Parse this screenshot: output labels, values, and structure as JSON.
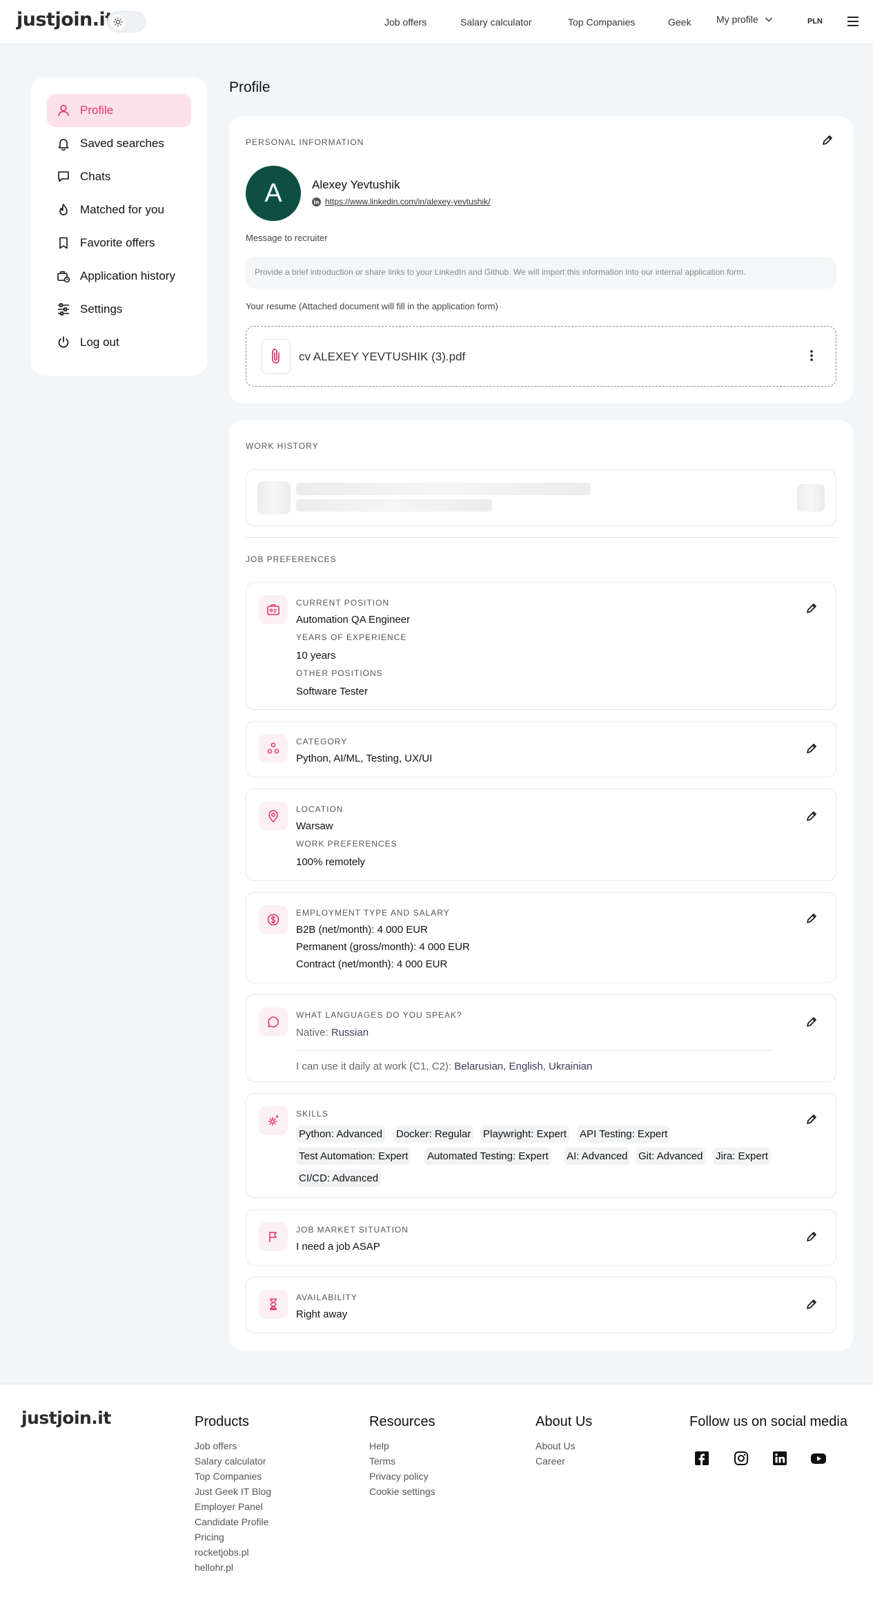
{
  "header": {
    "logo": "justjoin.it",
    "nav": [
      "Job offers",
      "Salary calculator",
      "Top Companies",
      "Geek"
    ],
    "my_profile": "My profile",
    "currency": "PLN"
  },
  "sidebar": {
    "items": [
      {
        "label": "Profile",
        "icon": "person-icon",
        "active": true
      },
      {
        "label": "Saved searches",
        "icon": "bell-icon"
      },
      {
        "label": "Chats",
        "icon": "chat-icon"
      },
      {
        "label": "Matched for you",
        "icon": "flame-icon"
      },
      {
        "label": "Favorite offers",
        "icon": "bookmark-icon"
      },
      {
        "label": "Application history",
        "icon": "briefcase-clock-icon"
      },
      {
        "label": "Settings",
        "icon": "sliders-icon"
      },
      {
        "label": "Log out",
        "icon": "power-icon"
      }
    ]
  },
  "page": {
    "title": "Profile"
  },
  "personal": {
    "section_title": "PERSONAL INFORMATION",
    "avatar_letter": "A",
    "name": "Alexey Yevtushik",
    "linkedin_url": "https://www.linkedin.com/in/alexey-yevtushik/",
    "message_label": "Message to recruiter",
    "message_placeholder": "Provide a brief introduction or share links to your LinkedIn and Github. We will import this information into our internal application form.",
    "resume_label": "Your resume (Attached document will fill in the application form)",
    "resume_file": "cv ALEXEY YEVTUSHIK (3).pdf"
  },
  "work": {
    "section_title": "WORK HISTORY"
  },
  "prefs": {
    "section_title": "JOB PREFERENCES",
    "position": {
      "current_label": "CURRENT POSITION",
      "current_value": "Automation QA Engineer",
      "years_label": "YEARS OF EXPERIENCE",
      "years_value": "10 years",
      "other_label": "OTHER POSITIONS",
      "other_value": "Software Tester"
    },
    "category": {
      "label": "CATEGORY",
      "value": "Python, AI/ML, Testing, UX/UI"
    },
    "location": {
      "label": "LOCATION",
      "value": "Warsaw",
      "work_label": "WORK PREFERENCES",
      "work_value": "100% remotely"
    },
    "employment": {
      "label": "EMPLOYMENT TYPE AND SALARY",
      "b2b_label": "B2B (net/month):",
      "b2b_value": "4 000 EUR",
      "permanent_label": "Permanent (gross/month):",
      "permanent_value": "4 000 EUR",
      "contract_label": "Contract (net/month):",
      "contract_value": "4 000 EUR"
    },
    "languages": {
      "label": "WHAT LANGUAGES DO YOU SPEAK?",
      "native_label": "Native:",
      "native_value": "Russian",
      "daily_label": "I can use it daily at work (C1, C2):",
      "daily_value": "Belarusian, English, Ukrainian"
    },
    "skills": {
      "label": "SKILLS",
      "items": [
        "Python: Advanced",
        "Docker: Regular",
        "Playwright: Expert",
        "API Testing: Expert",
        "Test Automation: Expert",
        "Automated Testing: Expert",
        "AI: Advanced",
        "Git: Advanced",
        "Jira: Expert",
        "CI/CD: Advanced"
      ]
    },
    "market": {
      "label": "JOB MARKET SITUATION",
      "value": "I need a job ASAP"
    },
    "availability": {
      "label": "AVAILABILITY",
      "value": "Right away"
    }
  },
  "footer": {
    "logo": "justjoin.it",
    "products_title": "Products",
    "products": [
      "Job offers",
      "Salary calculator",
      "Top Companies",
      "Just Geek IT Blog",
      "Employer Panel",
      "Candidate Profile",
      "Pricing",
      "rocketjobs.pl",
      "hellohr.pl"
    ],
    "resources_title": "Resources",
    "resources": [
      "Help",
      "Terms",
      "Privacy policy",
      "Cookie settings"
    ],
    "about_title": "About Us",
    "about": [
      "About Us",
      "Career"
    ],
    "social_title": "Follow us on social media",
    "social_icons": [
      "facebook-icon",
      "instagram-icon",
      "linkedin-icon",
      "youtube-icon"
    ]
  },
  "colors": {
    "accent": "#e1336d",
    "accent_bg": "#fde1ea",
    "avatar_bg": "#0d4f43",
    "page_bg": "#f3f6f8"
  }
}
